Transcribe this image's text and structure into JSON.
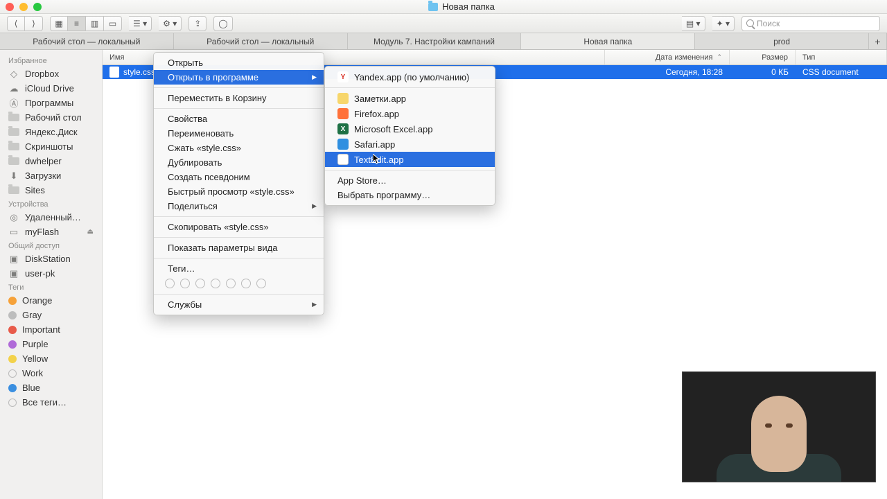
{
  "window": {
    "title": "Новая папка"
  },
  "search": {
    "placeholder": "Поиск"
  },
  "tabs": [
    "Рабочий стол — локальный",
    "Рабочий стол — локальный",
    "Модуль 7. Настройки кампаний",
    "Новая папка",
    "prod"
  ],
  "active_tab_index": 3,
  "sidebar": {
    "favorites_label": "Избранное",
    "favorites": [
      "Dropbox",
      "iCloud Drive",
      "Программы",
      "Рабочий стол",
      "Яндекс.Диск",
      "Скриншоты",
      "dwhelper",
      "Загрузки",
      "Sites"
    ],
    "devices_label": "Устройства",
    "devices": [
      "Удаленный…",
      "myFlash"
    ],
    "shared_label": "Общий доступ",
    "shared": [
      "DiskStation",
      "user-pk"
    ],
    "tags_label": "Теги",
    "tags": [
      {
        "name": "Orange",
        "color": "#f6a23a"
      },
      {
        "name": "Gray",
        "color": "#9e9e9e"
      },
      {
        "name": "Important",
        "color": "#e85b4a"
      },
      {
        "name": "Purple",
        "color": "#b06bd8"
      },
      {
        "name": "Yellow",
        "color": "#f3d24a"
      },
      {
        "name": "Work",
        "color": "#9e9e9e"
      },
      {
        "name": "Blue",
        "color": "#3b8fe0"
      },
      {
        "name": "Все теги…",
        "color": null
      }
    ]
  },
  "columns": {
    "name": "Имя",
    "date": "Дата изменения",
    "size": "Размер",
    "kind": "Тип"
  },
  "file": {
    "name": "style.css",
    "date": "Сегодня, 18:28",
    "size": "0 КБ",
    "kind": "CSS document"
  },
  "ctx": {
    "open": "Открыть",
    "open_with": "Открыть в программе",
    "trash": "Переместить в Корзину",
    "info": "Свойства",
    "rename": "Переименовать",
    "compress": "Сжать «style.css»",
    "duplicate": "Дублировать",
    "alias": "Создать псевдоним",
    "quicklook": "Быстрый просмотр «style.css»",
    "share": "Поделиться",
    "copy": "Скопировать «style.css»",
    "viewopts": "Показать параметры вида",
    "tags": "Теги…",
    "services": "Службы"
  },
  "submenu": {
    "default": "Yandex.app (по умолчанию)",
    "apps": [
      "Заметки.app",
      "Firefox.app",
      "Microsoft Excel.app",
      "Safari.app",
      "TextEdit.app"
    ],
    "selected_index": 4,
    "appstore": "App Store…",
    "other": "Выбрать программу…"
  },
  "app_colors": {
    "yandex": "#d93025",
    "notes": "#f7d66b",
    "firefox": "#ff7139",
    "excel": "#1e7145",
    "safari": "#2f8fe0",
    "textedit": "#ffffff"
  }
}
